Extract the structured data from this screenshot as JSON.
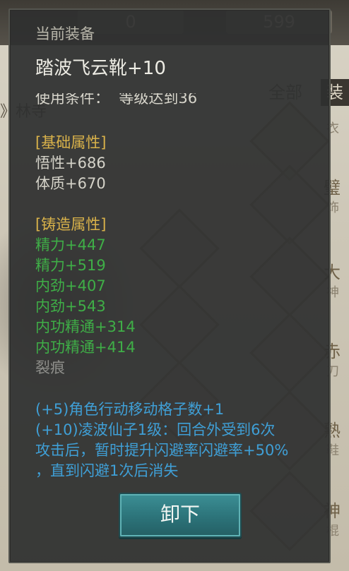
{
  "background": {
    "resources": [
      "0",
      "599"
    ],
    "tabs": [
      "全部",
      "装"
    ],
    "side_text": "》林寺",
    "items": [
      {
        "name": "",
        "sub": "衣"
      },
      {
        "name": "璧",
        "sub": "饰"
      },
      {
        "name": "大",
        "sub": "神"
      },
      {
        "name": "赤",
        "sub": "刀"
      },
      {
        "name": "熟",
        "sub": "鞋"
      },
      {
        "name": "神",
        "sub": "棍"
      }
    ]
  },
  "tooltip": {
    "header": "当前装备",
    "title": "踏波飞云靴+10",
    "condition": "使用条件：  等级达到36",
    "base_section": "[基础属性]",
    "base_stats": [
      "悟性+686",
      "体质+670"
    ],
    "forge_section": "[铸造属性]",
    "forge_stats": [
      "精力+447",
      "精力+519",
      "内劲+407",
      "内劲+543",
      "内功精通+314",
      "内功精通+414"
    ],
    "crack": "裂痕",
    "effects": [
      "(+5)角色行动移动格子数+1",
      "(+10)凌波仙子1级：回合外受到6次",
      "攻击后，暂时提升闪避率闪避率+50%",
      "，直到闪避1次后消失"
    ],
    "unequip_label": "卸下"
  }
}
